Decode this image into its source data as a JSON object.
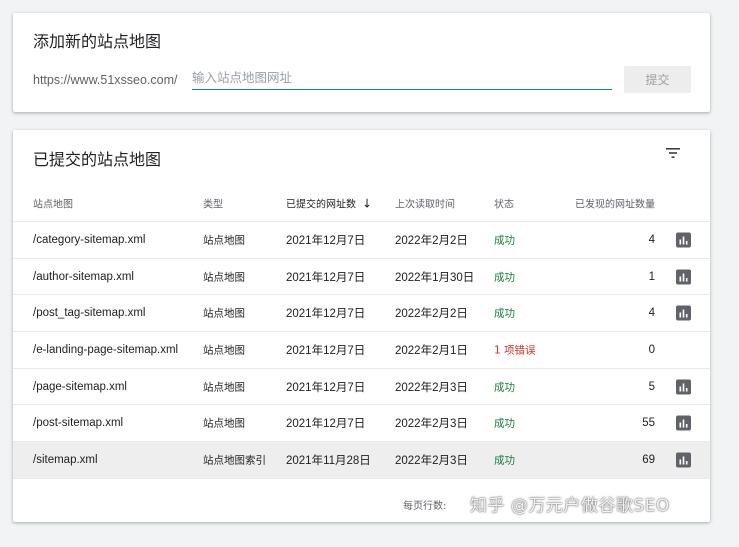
{
  "add_card": {
    "title": "添加新的站点地图",
    "url_prefix": "https://www.51xsseo.com/",
    "input_placeholder": "输入站点地图网址",
    "submit_label": "提交"
  },
  "list_card": {
    "title": "已提交的站点地图",
    "filter_icon": "filter-icon",
    "columns": {
      "sitemap": "站点地图",
      "type": "类型",
      "submitted": "已提交的网址数",
      "sort_arrow": "↓",
      "last_read": "上次读取时间",
      "status": "状态",
      "found": "已发现的网址数量"
    },
    "rows": [
      {
        "sitemap": "/category-sitemap.xml",
        "type": "站点地图",
        "submitted": "2021年12月7日",
        "last_read": "2022年2月2日",
        "status": "成功",
        "found": "4"
      },
      {
        "sitemap": "/author-sitemap.xml",
        "type": "站点地图",
        "submitted": "2021年12月7日",
        "last_read": "2022年1月30日",
        "status": "成功",
        "found": "1"
      },
      {
        "sitemap": "/post_tag-sitemap.xml",
        "type": "站点地图",
        "submitted": "2021年12月7日",
        "last_read": "2022年2月2日",
        "status": "成功",
        "found": "4"
      },
      {
        "sitemap": "/e-landing-page-sitemap.xml",
        "type": "站点地图",
        "submitted": "2021年12月7日",
        "last_read": "2022年2月1日",
        "status": "1 项错误",
        "found": "0"
      },
      {
        "sitemap": "/page-sitemap.xml",
        "type": "站点地图",
        "submitted": "2021年12月7日",
        "last_read": "2022年2月3日",
        "status": "成功",
        "found": "5"
      },
      {
        "sitemap": "/post-sitemap.xml",
        "type": "站点地图",
        "submitted": "2021年12月7日",
        "last_read": "2022年2月3日",
        "status": "成功",
        "found": "55"
      },
      {
        "sitemap": "/sitemap.xml",
        "type": "站点地图索引",
        "submitted": "2021年11月28日",
        "last_read": "2022年2月3日",
        "status": "成功",
        "found": "69"
      }
    ],
    "footer": {
      "rows_per_page_label": "每页行数:"
    }
  },
  "watermark": "知乎 @万元户做谷歌SEO",
  "colors": {
    "success": "#188038",
    "error": "#d93025",
    "accent": "#1a73e8"
  }
}
